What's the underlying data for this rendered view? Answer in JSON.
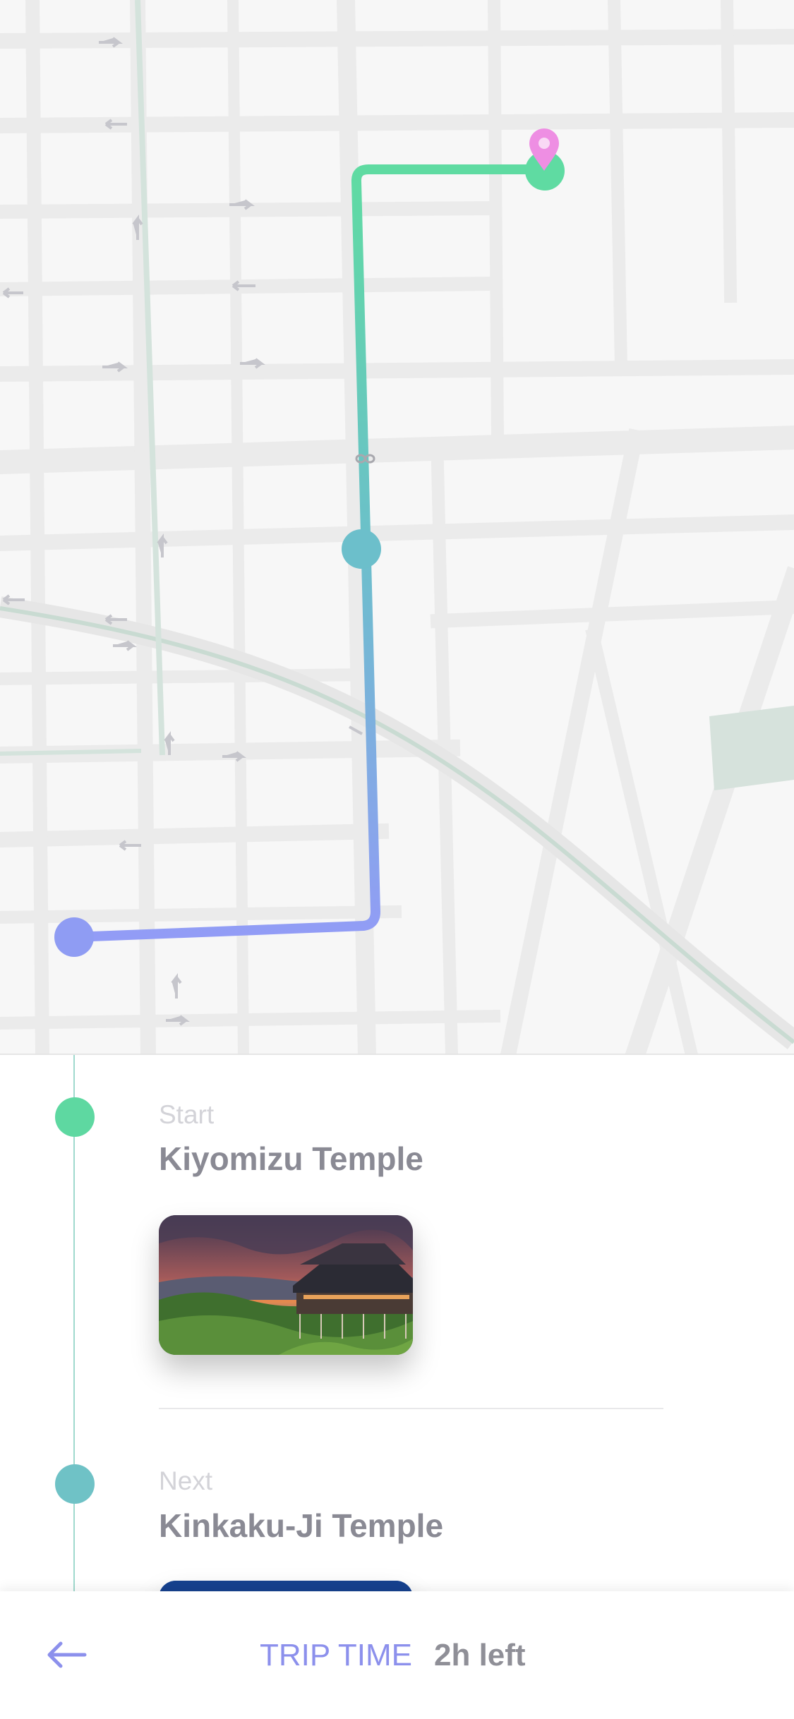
{
  "map": {
    "route_colors": {
      "start": "#62dba1",
      "middle": "#6fc2c6",
      "end": "#8f9cf3"
    },
    "destination_pin_color": "#ee8ee3",
    "park_color": "#d6e2dc"
  },
  "itinerary": {
    "stops": [
      {
        "caption": "Start",
        "name": "Kiyomizu Temple",
        "dot_color": "#5ed8a1"
      },
      {
        "caption": "Next",
        "name": "Kinkaku-Ji Temple",
        "dot_color": "#6fc2c6"
      }
    ]
  },
  "footer": {
    "back_icon": "arrow-left-icon",
    "trip_label": "TRIP TIME",
    "trip_value": "2h left",
    "accent": "#8c90ec"
  }
}
